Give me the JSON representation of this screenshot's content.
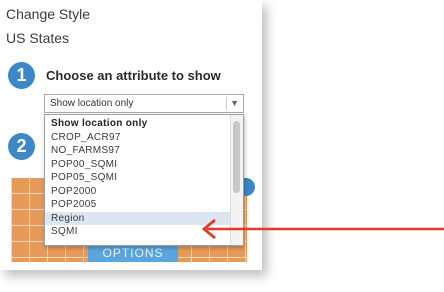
{
  "panel": {
    "title": "Change Style",
    "layer_name": "US States"
  },
  "step1": {
    "number": "1",
    "label": "Choose an attribute to show"
  },
  "step2": {
    "number": "2"
  },
  "attribute_select": {
    "value": "Show location only"
  },
  "dropdown_options": [
    "Show location only",
    "CROP_ACR97",
    "NO_FARMS97",
    "POP00_SQMI",
    "POP05_SQMI",
    "POP2000",
    "POP2005",
    "Region",
    "SQMI"
  ],
  "highlighted_option": "Region",
  "options_button": {
    "label": "OPTIONS"
  },
  "icons": {
    "select_chevron": "chevron-down-icon",
    "arrow": "red-pointer-arrow"
  },
  "colors": {
    "accent_blue": "#3d87c9",
    "map_orange": "#e59a5a",
    "highlight": "#dbe6f2",
    "arrow_red": "#e23b2a"
  }
}
